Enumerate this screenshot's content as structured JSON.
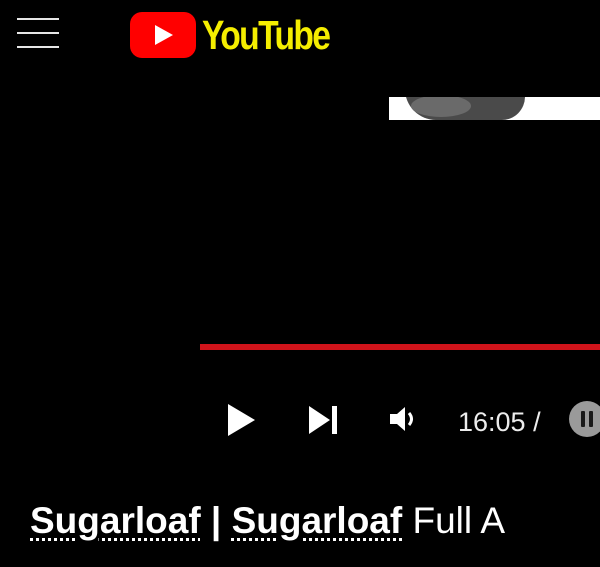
{
  "header": {
    "menu_icon": "hamburger-menu-icon",
    "logo_text": "YouTube",
    "logo_icon": "play-triangle-icon",
    "colors": {
      "logo_badge": "#ff0000",
      "logo_text": "#f5ee00"
    }
  },
  "player": {
    "progress_fraction": 1.0,
    "progress_color": "#d0131a",
    "controls": {
      "play_icon": "play-icon",
      "next_icon": "skip-next-icon",
      "volume_icon": "volume-icon",
      "autoplay_icon": "pause-toggle-icon"
    },
    "time_text": "16:05 /"
  },
  "video": {
    "title_link_1": "Sugarloaf",
    "title_separator": "|",
    "title_link_2": "Sugarloaf",
    "title_rest": "Full A"
  }
}
